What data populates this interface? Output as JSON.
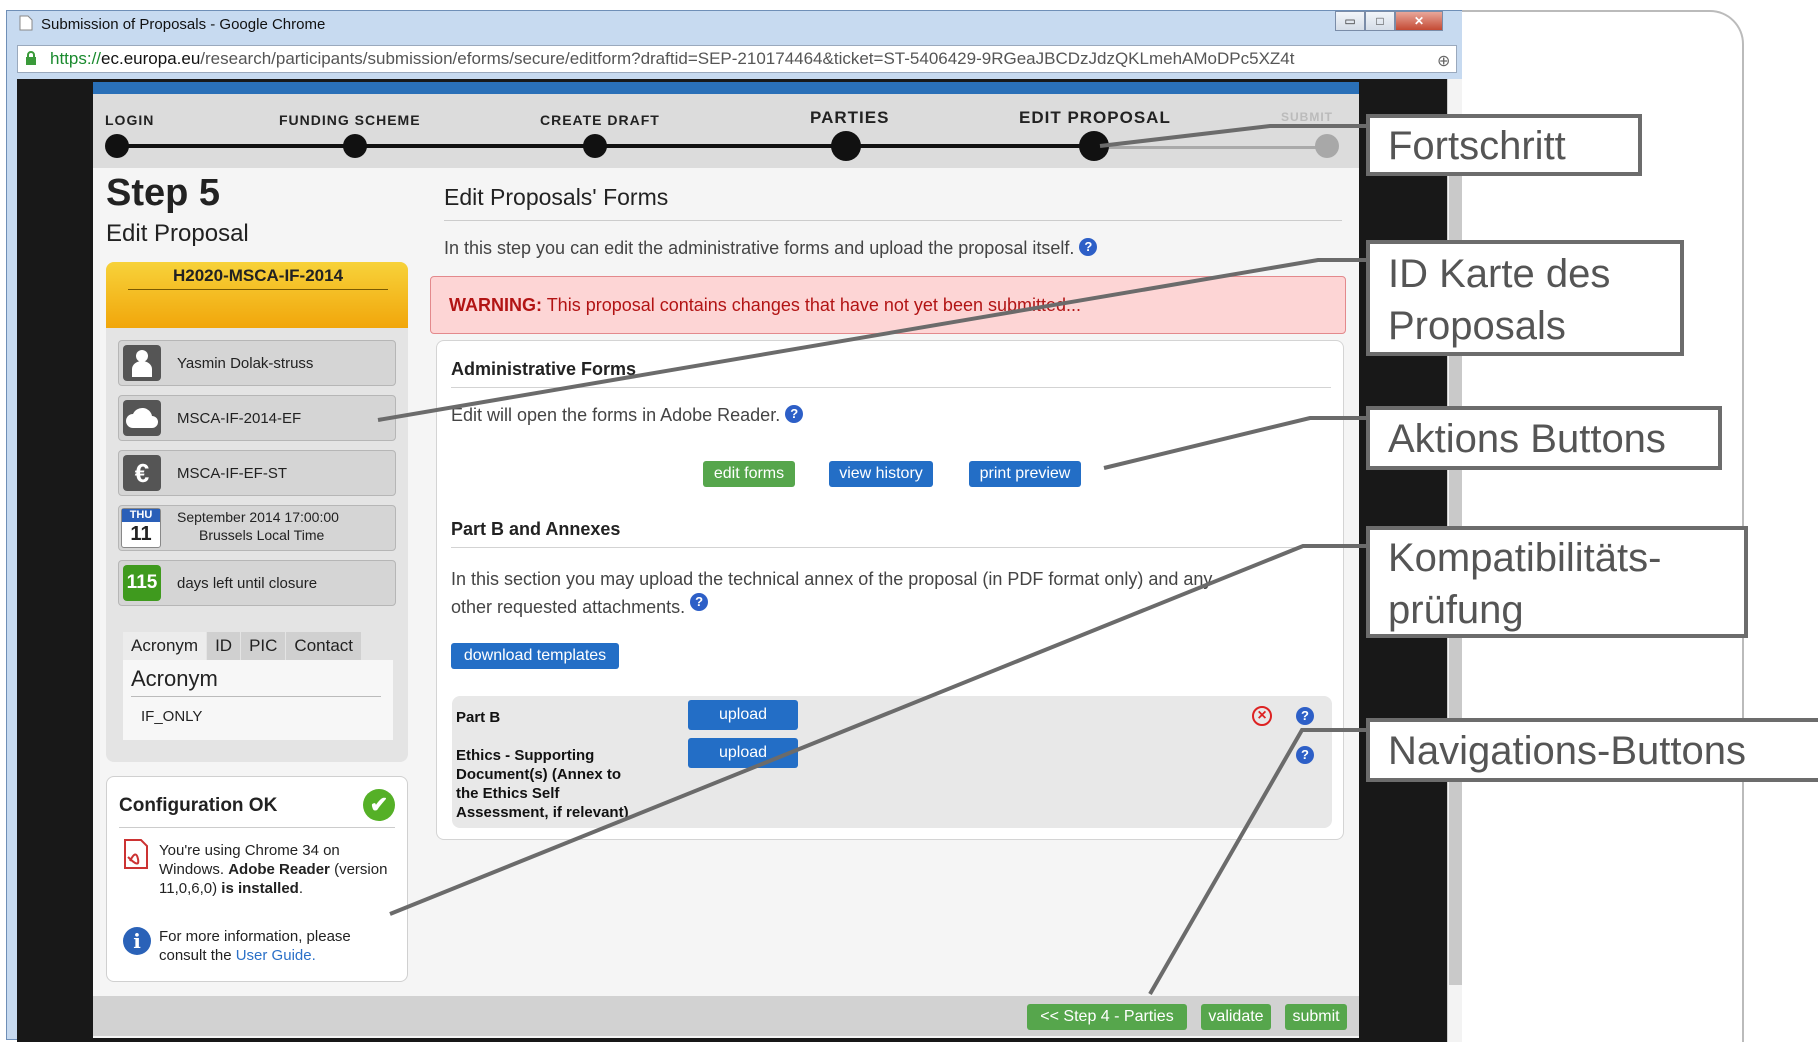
{
  "window": {
    "title": "Submission of Proposals - Google Chrome",
    "url_scheme": "https://",
    "url_host": "ec.europa.eu",
    "url_path": "/research/participants/submission/eforms/secure/editform?draftid=SEP-210174464&ticket=ST-5406429-9RGeaJBCDzJdzQKLmehAMoDPc5XZ4t",
    "minimize": "▭",
    "maximize": "□",
    "close": "✕"
  },
  "progress": {
    "steps": [
      {
        "label": "LOGIN"
      },
      {
        "label": "FUNDING SCHEME"
      },
      {
        "label": "CREATE DRAFT"
      },
      {
        "label": "PARTIES"
      },
      {
        "label": "EDIT PROPOSAL"
      },
      {
        "label": "SUBMIT"
      }
    ]
  },
  "step": {
    "title": "Step 5",
    "subtitle": "Edit Proposal"
  },
  "idcard": {
    "call": "H2020-MSCA-IF-2014",
    "user": "Yasmin Dolak-struss",
    "scheme": "MSCA-IF-2014-EF",
    "panel": "MSCA-IF-EF-ST",
    "date": "September 2014  17:00:00",
    "time_zone": "Brussels Local Time",
    "day_name": "THU",
    "day_num": "11",
    "days_left": "115",
    "days_left_label": "days left until closure",
    "tabs": [
      "Acronym",
      "ID",
      "PIC",
      "Contact"
    ],
    "acronym_label": "Acronym",
    "acronym_value": "IF_ONLY"
  },
  "config": {
    "title": "Configuration OK",
    "line1": "You're using Chrome 34 on Windows.",
    "adobe": "Adobe Reader",
    "version": "(version 11,0,6,0)",
    "is": "is",
    "installed": "installed",
    "info": "For more information, please consult the",
    "guide": "User Guide."
  },
  "main": {
    "title": "Edit Proposals' Forms",
    "intro": "In this step you can edit the administrative forms and upload the proposal itself.",
    "warning_label": "WARNING:",
    "warning_text": "This proposal contains changes that have not yet been submitted...",
    "admin_title": "Administrative Forms",
    "admin_text": "Edit will open the forms in Adobe Reader.",
    "btn_edit": "edit forms",
    "btn_history": "view history",
    "btn_print": "print preview",
    "partb_title": "Part B and Annexes",
    "partb_text1": "In this section you may upload the technical annex of the proposal (in PDF format only) and any",
    "partb_text2": "other requested attachments.",
    "btn_templates": "download templates",
    "row1_label": "Part B",
    "row2_label_lines": [
      "Ethics - Supporting",
      "Document(s) (Annex to",
      "the Ethics Self",
      "Assessment, if relevant)"
    ],
    "btn_upload": "upload",
    "help": "?",
    "remove": "×"
  },
  "nav": {
    "prev": "<< Step 4 - Parties",
    "validate": "validate",
    "submit": "submit"
  },
  "callouts": {
    "progress": "Fortschritt",
    "idcard_lines": [
      "ID Karte des",
      "Proposals"
    ],
    "actions": "Aktions Buttons",
    "compat_lines": [
      "Kompatibilitäts-",
      "prüfung"
    ],
    "nav": "Navigations-Buttons"
  },
  "colors": {
    "accent_blue": "#236ec6",
    "action_green": "#56a64c",
    "warning_red": "#b21414",
    "id_header": "#f1a60b"
  }
}
